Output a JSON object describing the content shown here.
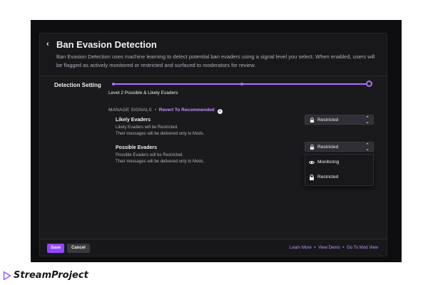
{
  "header": {
    "back_glyph": "‹",
    "title": "Ban Evasion Detection",
    "description": "Ban Evasion Detection uses machine learning to detect potential ban evaders using a signal level you select. When enabled, users will be flagged as actively monitored or restricted and surfaced to moderators for review."
  },
  "detection": {
    "label": "Detection Setting",
    "level_text": "Level 2  Possible & Likely Evaders",
    "slider_stops": 3,
    "slider_selected": 3
  },
  "signals": {
    "header_label": "MANAGE SIGNALS",
    "separator": "•",
    "revert_label": "Revert To Recommended",
    "info_glyph": "i",
    "items": [
      {
        "name": "Likely Evaders",
        "line1": "Likely Evaders will be Restricted.",
        "line2": "Their messages will be delivered only to Mods.",
        "select_value": "Restricted"
      },
      {
        "name": "Possible Evaders",
        "line1": "Possible Evaders will be Restricted.",
        "line2": "Their messages will be delivered only to Mods.",
        "select_value": "Restricted"
      }
    ],
    "dropdown_options": [
      {
        "label": "Monitoring",
        "icon": "eye-icon"
      },
      {
        "label": "Restricted",
        "icon": "lock-icon"
      }
    ]
  },
  "footer": {
    "save_label": "Save",
    "cancel_label": "Cancel",
    "links": [
      "Learn More",
      "View Demo",
      "Go To Mod View"
    ],
    "link_separator": "•"
  },
  "brand": {
    "name": "StreamProject",
    "logo_icon": "play-triangle-icon"
  },
  "colors": {
    "accent": "#a970ff",
    "button_primary": "#9147ff",
    "background": "#0e0e10",
    "panel": "#1a1a1d"
  }
}
